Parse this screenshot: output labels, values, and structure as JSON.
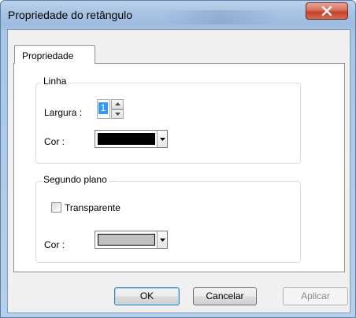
{
  "window": {
    "title": "Propriedade do retângulo",
    "close_glyph": "✕"
  },
  "tabs": [
    {
      "label": "Propriedade",
      "selected": true
    }
  ],
  "linha_group": {
    "title": "Linha",
    "width_label": "Largura :",
    "width_value": "1",
    "color_label": "Cor :",
    "color_value": "#000000"
  },
  "segundo_plano_group": {
    "title": "Segundo plano",
    "transparent_label": "Transparente",
    "transparent_checked": false,
    "color_label": "Cor :",
    "color_value": "#c0c0c0"
  },
  "buttons": {
    "ok_label": "OK",
    "cancel_label": "Cancelar",
    "apply_label": "Aplicar",
    "apply_enabled": false
  },
  "icons": {
    "close": "close-icon",
    "spin_up": "spin-up-icon",
    "spin_down": "spin-down-icon",
    "dropdown": "dropdown-arrow-icon"
  }
}
